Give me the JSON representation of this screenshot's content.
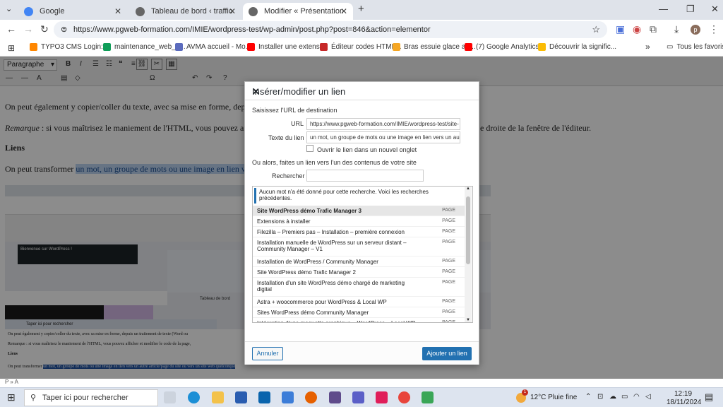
{
  "browser": {
    "tabs": [
      {
        "label": "Google",
        "color": "#4285f4"
      },
      {
        "label": "Tableau de bord ‹ traffic manag",
        "color": "#555"
      },
      {
        "label": "Modifier « Présentation de Wo",
        "color": "#555"
      }
    ],
    "url": "https://www.pgweb-formation.com/IMIE/wordpress-test/wp-admin/post.php?post=846&action=elementor",
    "profile_initial": "p",
    "bookmarks": [
      {
        "label": "TYPO3 CMS Login:...",
        "color": "#ff8700"
      },
      {
        "label": "maintenance_web_0...",
        "color": "#0f9d58"
      },
      {
        "label": "AVMA accueil - Mo...",
        "color": "#5b6bbd"
      },
      {
        "label": "Installer une extensi...",
        "color": "#ff0000"
      },
      {
        "label": "Éditeur codes HTML...",
        "color": "#c62828"
      },
      {
        "label": "Bras essuie glace arr...",
        "color": "#f5a623"
      },
      {
        "label": "(7) Google Analytics...",
        "color": "#ff0000"
      },
      {
        "label": "Découvrir la signific...",
        "color": "#fbbc05"
      }
    ],
    "all_favorites": "Tous les favoris"
  },
  "editor": {
    "format_select": "Paragraphe",
    "para1": "On peut également y copier/coller du texte, avec sa mise en forme, depu",
    "para2_prefix": "Remarque",
    "para2": " : si vous maîtrisez le maniement de l'HTML, vous pouvez affi",
    "para2_right": "e droite de la fenêtre de l'éditeur.",
    "heading": "Liens",
    "para3": "On peut transformer ",
    "para3_link": "un mot, un groupe de mots ou une image en lien ve",
    "status_path": "P » A"
  },
  "nested": {
    "caption1": "On peut également y copier/coller du texte, avec sa mise en forme, depuis un traitement de texte (Word ou",
    "caption2": "Remarque : si vous maîtrisez le maniement de l'HTML, vous pouvez afficher et modifier le code de la page,",
    "heading": "Liens",
    "caption3_prefix": "On peut transformer",
    "caption3_link": "un mot, un groupe de mots ou une image en lien vers un autre article/page du site ou vers un site web quelconque",
    "welcome": "Bienvenue sur WordPress !",
    "search": "Taper ici pour rechercher",
    "tableau": "Tableau de bord"
  },
  "dialog": {
    "title": "Insérer/modifier un lien",
    "url_prompt": "Saisissez l'URL de destination",
    "url_label": "URL",
    "url_value": "https://www.pgweb-formation.com/IMIE/wordpress-test/site-",
    "text_label": "Texte du lien",
    "text_value": "un mot, un groupe de mots ou une image en lien vers un au",
    "new_tab_label": "Ouvrir le lien dans un nouvel onglet",
    "or_label": "Ou alors, faites un lien vers l'un des contenus de votre site",
    "search_label": "Rechercher",
    "search_value": "",
    "notice": "Aucun mot n'a été donné pour cette recherche. Voici les recherches précédentes.",
    "results": [
      {
        "title": "Site WordPress démo Trafic Manager 3",
        "type": "PAGE"
      },
      {
        "title": "Extensions à installer",
        "type": "PAGE"
      },
      {
        "title": "Filezilla – Premiers pas – Installation – première connexion",
        "type": "PAGE"
      },
      {
        "title": "Installation manuelle de WordPress sur un serveur distant – Community Manager – V1",
        "type": "PAGE"
      },
      {
        "title": "Installation de WordPress / Community Manager",
        "type": "PAGE"
      },
      {
        "title": "Site WordPress démo Trafic Manager 2",
        "type": "PAGE"
      },
      {
        "title": "Installation d'un site WordPress démo chargé de marketing digital",
        "type": "PAGE"
      },
      {
        "title": "Astra + woocommerce pour WordPress & Local WP",
        "type": "PAGE"
      },
      {
        "title": "Sites WordPress démo Community Manager",
        "type": "PAGE"
      },
      {
        "title": "Intégration d'une maquette graphique – WordPress – Local WP",
        "type": "PAGE"
      }
    ],
    "cancel": "Annuler",
    "submit": "Ajouter un lien"
  },
  "taskbar": {
    "search_placeholder": "Taper ici pour rechercher",
    "weather": "12°C  Pluie fine",
    "time": "12:19",
    "date": "18/11/2024",
    "notif_count": "1"
  },
  "colors": {
    "accent": "#2271b1",
    "highlight": "#bcd3f0"
  }
}
